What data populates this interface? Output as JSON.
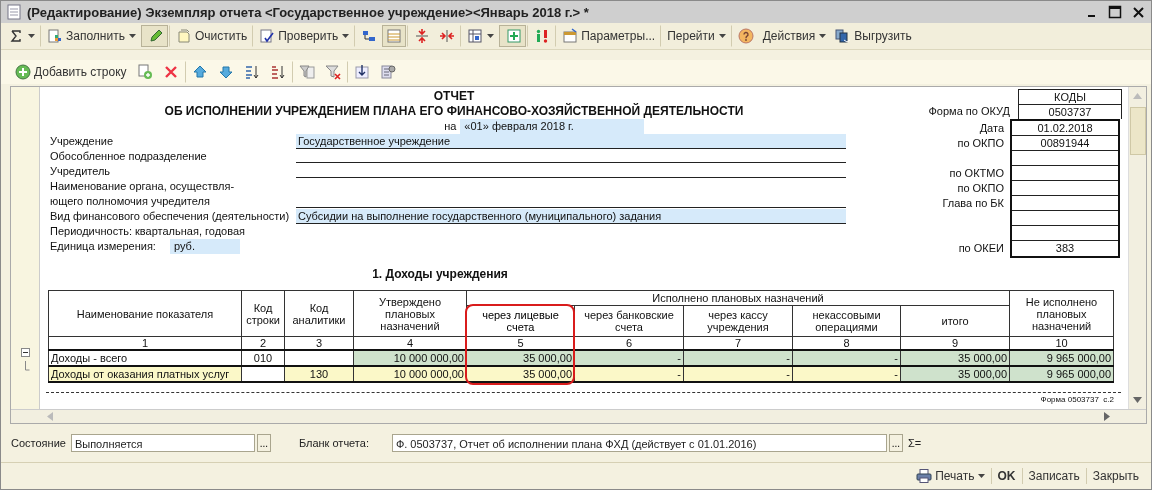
{
  "window": {
    "title": "(Редактирование) Экземпляр отчета <Государственное учреждение><Январь 2018 г.> *"
  },
  "toolbar": [
    {
      "dropdown": true,
      "pressed": false,
      "separator_before": false
    },
    {
      "label": "Заполнить",
      "dropdown": true,
      "pressed": false,
      "separator_before": true
    },
    {
      "dropdown": false,
      "pressed": true,
      "separator_before": true
    },
    {
      "label": "Очистить",
      "dropdown": false,
      "pressed": false,
      "separator_before": true
    },
    {
      "label": "Проверить",
      "dropdown": true,
      "pressed": false,
      "separator_before": true
    },
    {
      "dropdown": false,
      "pressed": false,
      "separator_before": true
    },
    {
      "dropdown": false,
      "pressed": true,
      "separator_before": false
    },
    {
      "dropdown": false,
      "pressed": false,
      "separator_before": true
    },
    {
      "dropdown": false,
      "pressed": false,
      "separator_before": false
    },
    {
      "dropdown": true,
      "pressed": false,
      "separator_before": true
    },
    {
      "dropdown": false,
      "pressed": true,
      "separator_before": true
    },
    {
      "dropdown": false,
      "pressed": false,
      "separator_before": true
    },
    {
      "label": "Параметры...",
      "dropdown": false,
      "pressed": false,
      "separator_before": true
    },
    {
      "label": "Перейти",
      "dropdown": true,
      "pressed": false,
      "separator_before": true
    },
    {
      "dropdown": false,
      "pressed": false,
      "separator_before": true
    },
    {
      "label": "Действия",
      "dropdown": true,
      "pressed": false,
      "separator_before": false
    },
    {
      "label": "Выгрузить",
      "dropdown": false,
      "pressed": false,
      "separator_before": false
    }
  ],
  "row_toolbar": [
    {
      "label": "Добавить строку",
      "separator_before": false
    },
    {
      "separator_before": false
    },
    {
      "separator_before": false
    },
    {
      "separator_before": true
    },
    {
      "separator_before": false
    },
    {
      "separator_before": false
    },
    {
      "separator_before": false
    },
    {
      "separator_before": true
    },
    {
      "separator_before": false
    },
    {
      "separator_before": true
    },
    {
      "separator_before": false
    }
  ],
  "report": {
    "title": "ОТЧЕТ",
    "subtitle": "ОБ ИСПОЛНЕНИИ УЧРЕЖДЕНИЕМ ПЛАНА ЕГО ФИНАНСОВО-ХОЗЯЙСТВЕННОЙ ДЕЯТЕЛЬНОСТИ",
    "date_prefix": "на",
    "date": "«01» февраля 2018 г.",
    "fields": [
      {
        "label": [
          "Учреждение"
        ],
        "value": "Государственное учреждение",
        "kind": "filled"
      },
      {
        "label": [
          "Обособленное подразделение"
        ],
        "kind": "line"
      },
      {
        "label": [
          "Учредитель"
        ],
        "kind": "line"
      },
      {
        "label": [
          "Наименование органа, осуществля-",
          "ющего полномочия учредителя"
        ],
        "kind": "line"
      },
      {
        "label": [
          "Вид финансового обеспечения (деятельности)"
        ],
        "value": "Субсидии на выполнение государственного (муниципального) задания",
        "kind": "filled"
      },
      {
        "label": [
          "Периодичность: квартальная, годовая"
        ],
        "kind": "none"
      },
      {
        "label": [
          "Единица измерения:"
        ],
        "value": "руб.",
        "kind": "inline"
      }
    ],
    "codes": {
      "header": "КОДЫ",
      "rows": [
        {
          "label": "Форма по ОКУД",
          "value": "0503737"
        },
        {
          "label": "Дата",
          "value": "01.02.2018"
        },
        {
          "label": "по ОКПО",
          "value": "00891944"
        },
        {},
        {
          "label": "по ОКТМО"
        },
        {
          "label": "по ОКПО"
        },
        {
          "label": "Глава по БК"
        },
        {},
        {},
        {
          "label": "по ОКЕИ",
          "value": "383"
        }
      ]
    },
    "section_title": "1. Доходы учреждения",
    "table": {
      "group_label": "Исполнено плановых назначений",
      "columns": [
        {
          "label": "Наименование показателя",
          "number": "1",
          "in_group": false,
          "highlighted": false
        },
        {
          "label": "Код строки",
          "number": "2",
          "in_group": false,
          "highlighted": false
        },
        {
          "label": "Код аналитики",
          "number": "3",
          "in_group": false,
          "highlighted": false
        },
        {
          "label": "Утверждено плановых назначений",
          "number": "4",
          "in_group": false,
          "highlighted": false
        },
        {
          "label": "через лицевые счета",
          "number": "5",
          "in_group": true,
          "highlighted": true
        },
        {
          "label": "через банковские счета",
          "number": "6",
          "in_group": true,
          "highlighted": false
        },
        {
          "label": "через кассу учреждения",
          "number": "7",
          "in_group": true,
          "highlighted": false
        },
        {
          "label": "некассовыми операциями",
          "number": "8",
          "in_group": true,
          "highlighted": false
        },
        {
          "label": "итого",
          "number": "9",
          "in_group": true,
          "highlighted": false
        },
        {
          "label": "Не исполнено плановых назначений",
          "number": "10",
          "in_group": false,
          "highlighted": false
        }
      ],
      "rows": [
        {
          "expanded": true,
          "cells": [
            {
              "text": "Доходы - всего",
              "kind": "plain"
            },
            {
              "text": "010",
              "kind": "plain"
            },
            {
              "kind": "plain"
            },
            {
              "text": "10 000 000,00",
              "kind": "calc"
            },
            {
              "text": "35 000,00",
              "kind": "calc"
            },
            {
              "text": "-",
              "kind": "calc"
            },
            {
              "text": "-",
              "kind": "calc"
            },
            {
              "text": "-",
              "kind": "calc"
            },
            {
              "text": "35 000,00",
              "kind": "calc"
            },
            {
              "text": "9 965 000,00",
              "kind": "calc"
            }
          ]
        },
        {
          "cells": [
            {
              "text": "Доходы от оказания платных услуг",
              "kind": "input"
            },
            {
              "kind": "plain"
            },
            {
              "text": "130",
              "kind": "input"
            },
            {
              "text": "10 000 000,00",
              "kind": "input"
            },
            {
              "text": "35 000,00",
              "kind": "input"
            },
            {
              "text": "-",
              "kind": "input"
            },
            {
              "text": "-",
              "kind": "input"
            },
            {
              "text": "-",
              "kind": "input"
            },
            {
              "text": "35 000,00",
              "kind": "calc"
            },
            {
              "text": "9 965 000,00",
              "kind": "calc"
            }
          ]
        }
      ]
    },
    "page_footer": "Форма 0503737  с.2"
  },
  "bottom": {
    "status_label": "Состояние",
    "status_value": "Выполняется",
    "status_button": "...",
    "form_label": "Бланк отчета:",
    "form_value": "Ф. 0503737, Отчет об исполнении плана ФХД (действует с 01.01.2016)",
    "form_button": "...",
    "sum_label": "Σ="
  },
  "footer": [
    {
      "label": "Печать",
      "dropdown": true,
      "bold": false
    },
    {
      "label": "OK",
      "dropdown": false,
      "bold": true
    },
    {
      "label": "Записать",
      "dropdown": false,
      "bold": false
    },
    {
      "label": "Закрыть",
      "dropdown": false,
      "bold": false
    }
  ]
}
